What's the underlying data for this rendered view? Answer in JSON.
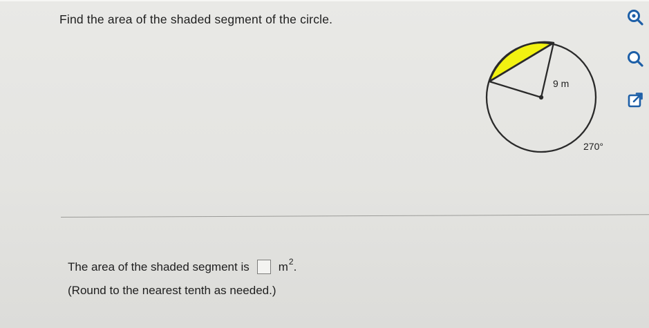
{
  "question": {
    "text": "Find the area of the shaded segment of the circle."
  },
  "figure": {
    "radius_label": "9 m",
    "angle_label": "270°",
    "central_angle_deg": 270,
    "shade_color": "#f2f211",
    "circle_color": "#2a2a2a"
  },
  "toolbar": {
    "icons": [
      "zoom-in-icon",
      "zoom-out-icon",
      "external-link-icon"
    ],
    "accent_color": "#1d5fa7"
  },
  "answer": {
    "prefix": "The area of the shaded segment is",
    "value": "",
    "unit_base": "m",
    "unit_exponent": "2",
    "suffix": ".",
    "note": "(Round to the nearest tenth as needed.)"
  }
}
